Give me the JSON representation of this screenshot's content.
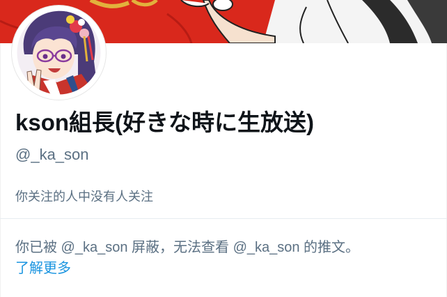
{
  "banner": {
    "description": "profile-header-illustration"
  },
  "avatar": {
    "description": "anime-character-avatar"
  },
  "profile": {
    "display_name": "kson組長(好きな時に生放送)",
    "handle": "@_ka_son",
    "follow_info": "你关注的人中没有人关注"
  },
  "blocked_notice": {
    "message": "你已被 @_ka_son 屏蔽，无法查看 @_ka_son 的推文。",
    "learn_more": "了解更多"
  },
  "colors": {
    "primary_text": "#0f1419",
    "secondary_text": "#5b7083",
    "link": "#1b95e0",
    "banner_red": "#d7261b"
  }
}
